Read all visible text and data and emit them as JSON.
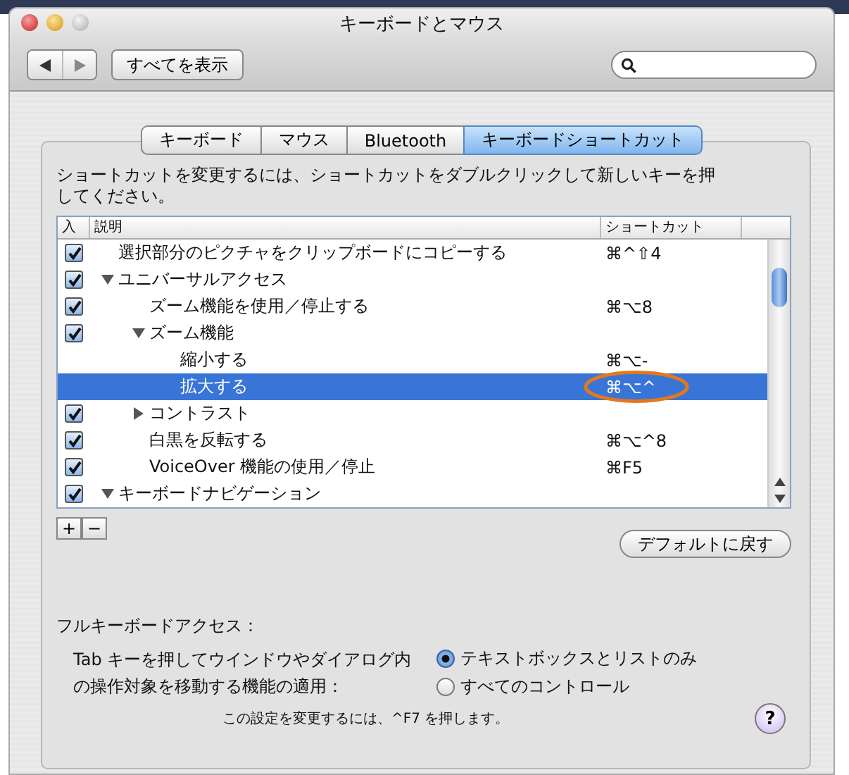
{
  "window": {
    "title": "キーボードとマウス"
  },
  "toolbar": {
    "show_all": "すべてを表示"
  },
  "tabs": [
    {
      "label": "キーボード",
      "selected": false
    },
    {
      "label": "マウス",
      "selected": false
    },
    {
      "label": "Bluetooth",
      "selected": false
    },
    {
      "label": "キーボードショートカット",
      "selected": true
    }
  ],
  "instructions": "ショートカットを変更するには、ショートカットをダブルクリックして新しいキーを押してください。",
  "list": {
    "columns": [
      "入",
      "説明",
      "ショートカット"
    ],
    "rows": [
      {
        "label": "選択部分のピクチャをクリップボードにコピーする",
        "shortcut": "⌘^⇧4",
        "checked": true,
        "selected": false
      },
      {
        "label": "ユニバーサルアクセス",
        "checked": true,
        "expanded": true,
        "selected": false,
        "children": [
          {
            "label": "ズーム機能を使用／停止する",
            "shortcut": "⌘⌥8",
            "checked": true,
            "selected": false
          },
          {
            "label": "ズーム機能",
            "checked": true,
            "expanded": true,
            "selected": false,
            "children": [
              {
                "label": "縮小する",
                "shortcut": "⌘⌥-",
                "selected": false
              },
              {
                "label": "拡大する",
                "shortcut": "⌘⌥^",
                "selected": true,
                "circled": true
              }
            ]
          },
          {
            "label": "コントラスト",
            "checked": true,
            "expanded": false,
            "selected": false
          },
          {
            "label": "白黒を反転する",
            "shortcut": "⌘⌥^8",
            "checked": true,
            "selected": false
          },
          {
            "label": "VoiceOver 機能の使用／停止",
            "shortcut": "⌘F5",
            "checked": true,
            "selected": false
          }
        ]
      },
      {
        "label": "キーボードナビゲーション",
        "checked": true,
        "expanded": true,
        "selected": false
      }
    ]
  },
  "add_label": "+",
  "remove_label": "−",
  "default_button": "デフォルトに戻す",
  "full_access": {
    "heading": "フルキーボードアクセス：",
    "question": "Tab キーを押してウインドウやダイアログ内の操作対象を移動する機能の適用：",
    "options": [
      {
        "label": "テキストボックスとリストのみ",
        "selected": true
      },
      {
        "label": "すべてのコントロール",
        "selected": false
      }
    ],
    "note": "この設定を変更するには、^F7 を押します。",
    "help": "?"
  }
}
